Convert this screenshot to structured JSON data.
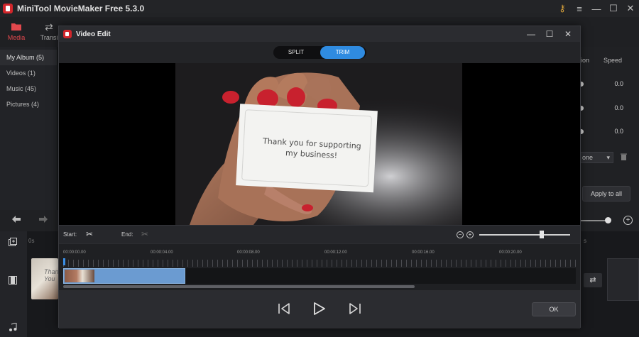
{
  "app": {
    "title": "MiniTool MovieMaker Free 5.3.0",
    "window_controls": {
      "key": "⚷",
      "menu": "≡",
      "minimize": "—",
      "maximize": "☐",
      "close": "✕"
    }
  },
  "toolbar": {
    "items": [
      {
        "label": "Media",
        "icon": "folder-icon"
      },
      {
        "label": "Transi",
        "icon": "transition-icon"
      }
    ]
  },
  "sidebar": {
    "items": [
      {
        "label": "My Album (5)"
      },
      {
        "label": "Videos (1)"
      },
      {
        "label": "Music (45)"
      },
      {
        "label": "Pictures (4)"
      }
    ]
  },
  "right_panel": {
    "tab_partial": "ion",
    "tab_speed": "Speed",
    "values": [
      "0.0",
      "0.0",
      "0.0"
    ],
    "select_value": "one",
    "apply_label": "Apply to all"
  },
  "timeline": {
    "ruler_start": "0s",
    "ruler_right": "s",
    "clip_text": "Thank You"
  },
  "dialog": {
    "title": "Video Edit",
    "mode": {
      "split": "SPLIT",
      "trim": "TRIM",
      "active": "TRIM"
    },
    "card_text_line1": "Thank you for supporting",
    "card_text_line2": "my business!",
    "start_label": "Start:",
    "end_label": "End:",
    "zoom_out": "−",
    "zoom_in": "+",
    "ruler": [
      "00:00:00.00",
      "00:00:04.00",
      "00:00:08.00",
      "00:00:12.00",
      "00:00:16.00",
      "00:00:20.00"
    ],
    "ok_label": "OK"
  }
}
